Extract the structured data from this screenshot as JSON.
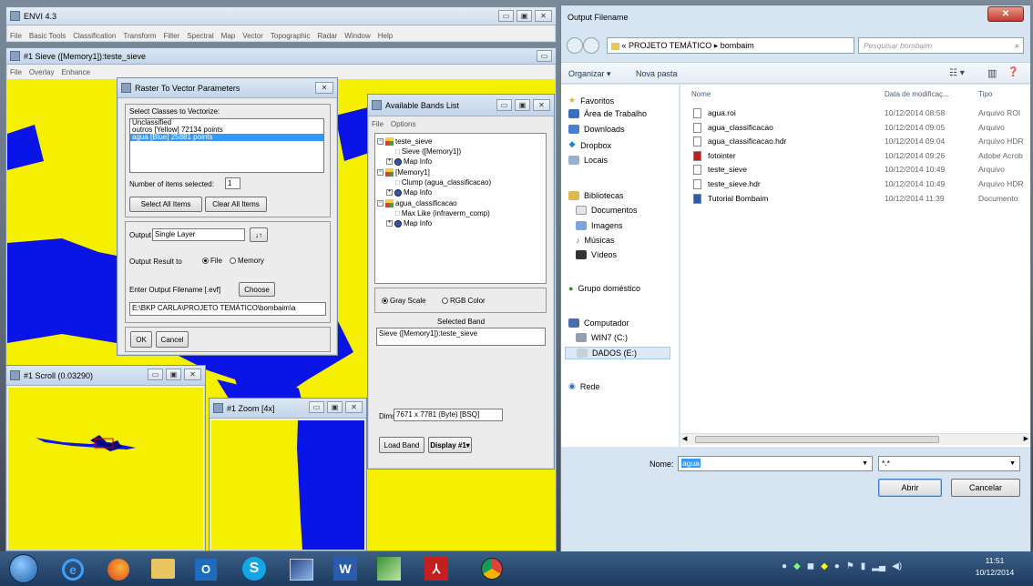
{
  "envi_main": {
    "title": "ENVI 4.3",
    "menu": [
      "File",
      "Basic Tools",
      "Classification",
      "Transform",
      "Filter",
      "Spectral",
      "Map",
      "Vector",
      "Topographic",
      "Radar",
      "Window",
      "Help"
    ]
  },
  "sieve_window": {
    "title": "#1 Sieve ([Memory1]):teste_sieve",
    "menu": [
      "File",
      "Overlay",
      "Enhance"
    ]
  },
  "raster_dialog": {
    "title": "Raster To Vector Parameters",
    "select_label": "Select Classes to Vectorize:",
    "classes": [
      "Unclassified",
      "outros [Yellow] 72134 points",
      "agua [Blue] 25881 points"
    ],
    "num_selected_label": "Number of items selected:",
    "num_selected": "1",
    "select_all": "Select All Items",
    "clear_all": "Clear All Items",
    "output_label": "Output",
    "output_value": "Single Layer",
    "output_result_label": "Output Result to",
    "opt_file": "File",
    "opt_memory": "Memory",
    "enter_filename_label": "Enter Output Filename [.evf]",
    "choose": "Choose",
    "path": "E:\\BKP CARLA\\PROJETO TEMÁTICO\\bombaim\\a",
    "ok": "OK",
    "cancel": "Cancel"
  },
  "bands_window": {
    "title": "Available Bands List",
    "menu": [
      "File",
      "Options"
    ],
    "tree": [
      "teste_sieve",
      "Sieve ([Memory1])",
      "Map Info",
      "[Memory1]",
      "Clump (agua_classificacao)",
      "Map Info",
      "agua_classificacao",
      "Max Like (infraverm_comp)",
      "Map Info"
    ],
    "gray_scale": "Gray Scale",
    "rgb_color": "RGB Color",
    "selected_band_label": "Selected Band",
    "selected_band": "Sieve ([Memory1]):teste_sieve",
    "dims_label": "Dims",
    "dims": "7671 x 7781 (Byte) [BSQ]",
    "load_band": "Load Band",
    "display": "Display #1"
  },
  "scroll_window": {
    "title": "#1 Scroll (0.03290)"
  },
  "zoom_window": {
    "title": "#1 Zoom [4x]"
  },
  "file_dialog": {
    "title": "Output Filename",
    "breadcrumb": [
      "«",
      "PROJETO TEMÁTICO",
      "bombaim"
    ],
    "search_placeholder": "Pesquisar bombaim",
    "organize": "Organizar ▾",
    "new_folder": "Nova pasta",
    "nav": {
      "favorites_header": "Favoritos",
      "favorites": [
        "Área de Trabalho",
        "Downloads",
        "Dropbox",
        "Locais"
      ],
      "libraries_header": "Bibliotecas",
      "libraries": [
        "Documentos",
        "Imagens",
        "Músicas",
        "Vídeos"
      ],
      "homegroup": "Grupo doméstico",
      "computer_header": "Computador",
      "drives": [
        "WIN7 (C:)",
        "DADOS (E:)"
      ],
      "network": "Rede"
    },
    "columns": [
      "Nome",
      "Data de modificaç...",
      "Tipo"
    ],
    "files": [
      {
        "name": "agua.roi",
        "date": "10/12/2014 08:58",
        "type": "Arquivo ROI"
      },
      {
        "name": "agua_classificacao",
        "date": "10/12/2014 09:05",
        "type": "Arquivo"
      },
      {
        "name": "agua_classificacao.hdr",
        "date": "10/12/2014 09:04",
        "type": "Arquivo HDR"
      },
      {
        "name": "fotointer",
        "date": "10/12/2014 09:26",
        "type": "Adobe Acrob"
      },
      {
        "name": "teste_sieve",
        "date": "10/12/2014 10:49",
        "type": "Arquivo"
      },
      {
        "name": "teste_sieve.hdr",
        "date": "10/12/2014 10:49",
        "type": "Arquivo HDR"
      },
      {
        "name": "Tutorial Bombaim",
        "date": "10/12/2014 11:39",
        "type": "Documento"
      }
    ],
    "name_label": "Nome:",
    "name_value": "agua",
    "filter_value": "*.*",
    "open": "Abrir",
    "cancel": "Cancelar"
  },
  "taskbar": {
    "time": "11:51",
    "date": "10/12/2014"
  },
  "colors": {
    "yellow": "#f5ef00",
    "blue": "#0a14e6",
    "selection": "#3399ff",
    "taskbar": "#1c3a5e"
  }
}
